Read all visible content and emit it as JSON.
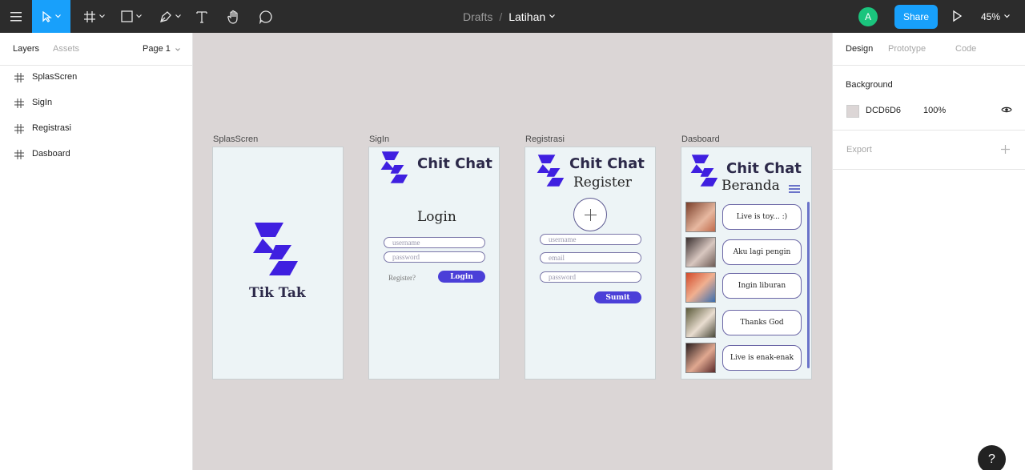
{
  "toolbar": {
    "breadcrumb_root": "Drafts",
    "breadcrumb_sep": "/",
    "file_name": "Latihan",
    "avatar_initial": "A",
    "share_label": "Share",
    "zoom_label": "45%",
    "accent_color": "#18a0fb"
  },
  "left_panel": {
    "tabs": [
      "Layers",
      "Assets"
    ],
    "page_selector": "Page 1",
    "layers": [
      "SplasScren",
      "SigIn",
      "Registrasi",
      "Dasboard"
    ]
  },
  "canvas": {
    "background": "#DCD6D6",
    "frames": {
      "splash": {
        "label": "SplasScren",
        "app_name": "Tik Tak"
      },
      "signin": {
        "label": "SigIn",
        "app_name": "Chit Chat",
        "heading": "Login",
        "username_placeholder": "username",
        "password_placeholder": "password",
        "register_link": "Register?",
        "login_button": "Login"
      },
      "register": {
        "label": "Registrasi",
        "app_name": "Chit Chat",
        "heading": "Register",
        "username_placeholder": "username",
        "email_placeholder": "email",
        "password_placeholder": "password",
        "submit_button": "Sumit"
      },
      "dashboard": {
        "label": "Dasboard",
        "app_name": "Chit Chat",
        "heading": "Beranda",
        "chats": [
          "Live is toy... :)",
          "Aku lagi pengin",
          "Ingin liburan",
          "Thanks God",
          "Live is enak-enak"
        ]
      }
    }
  },
  "right_panel": {
    "tabs": [
      "Design",
      "Prototype",
      "Code"
    ],
    "background_title": "Background",
    "background_hex": "DCD6D6",
    "background_opacity": "100%",
    "export_label": "Export"
  },
  "help_label": "?"
}
